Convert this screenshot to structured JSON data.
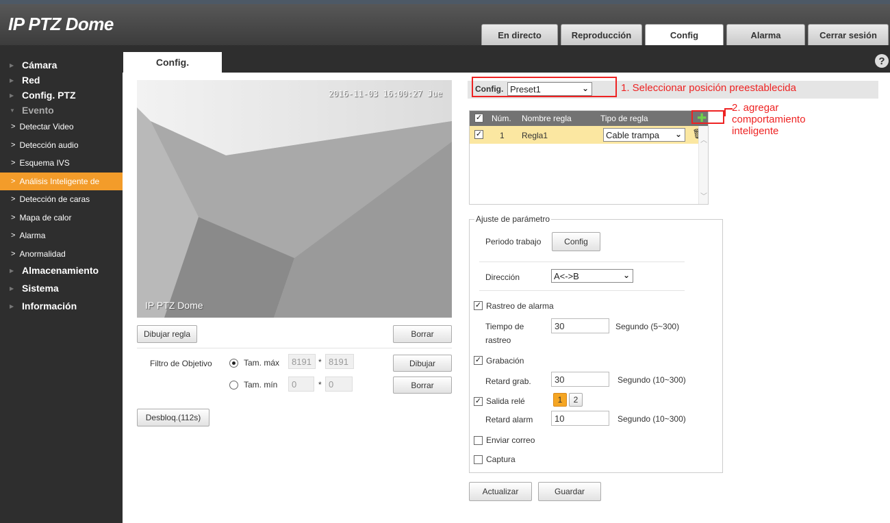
{
  "app": {
    "title": "IP PTZ Dome"
  },
  "tabs": [
    {
      "label": "En directo"
    },
    {
      "label": "Reproducción"
    },
    {
      "label": "Config",
      "active": true
    },
    {
      "label": "Alarma"
    },
    {
      "label": "Cerrar sesión"
    }
  ],
  "sidebar": {
    "top": [
      {
        "label": "Cámara"
      },
      {
        "label": "Red"
      },
      {
        "label": "Config. PTZ"
      },
      {
        "label": "Evento"
      }
    ],
    "sub": [
      {
        "label": "Detectar Video"
      },
      {
        "label": "Detección audio"
      },
      {
        "label": "Esquema IVS"
      },
      {
        "label": "Análisis Inteligente de",
        "active": true
      },
      {
        "label": "Detección de caras"
      },
      {
        "label": "Mapa de calor"
      },
      {
        "label": "Alarma"
      },
      {
        "label": "Anormalidad"
      }
    ],
    "bottom": [
      {
        "label": "Almacenamiento"
      },
      {
        "label": "Sistema"
      },
      {
        "label": "Información"
      }
    ]
  },
  "page": {
    "tab_label": "Config.",
    "help": "?"
  },
  "video": {
    "timestamp": "2016-11-03 16:00:27 Jue",
    "channel_name": "IP PTZ Dome"
  },
  "left": {
    "draw_rule": "Dibujar regla",
    "clear": "Borrar",
    "target_filter": "Filtro de Objetivo",
    "max_size": "Tam. máx",
    "min_size": "Tam. mín",
    "max_w": "8191",
    "max_h": "8191",
    "min_w": "0",
    "min_h": "0",
    "times": "*",
    "draw": "Dibujar",
    "clear2": "Borrar",
    "unlock": "Desbloq.(112s)"
  },
  "config": {
    "label": "Config.",
    "preset": "Preset1",
    "note1": "1. Seleccionar posición preestablecida",
    "note2_line1": "2. agregar",
    "note2_line2": "comportamiento",
    "note2_line3": "inteligente"
  },
  "rules": {
    "headers": {
      "num": "Núm.",
      "name": "Nombre regla",
      "type": "Tipo de regla"
    },
    "rows": [
      {
        "num": "1",
        "name": "Regla1",
        "type": "Cable trampa"
      }
    ]
  },
  "params": {
    "legend": "Ajuste de parámetro",
    "work_period": "Periodo trabajo",
    "config_btn": "Config",
    "direction": "Dirección",
    "direction_value": "A<->B",
    "alarm_track": "Rastreo de alarma",
    "track_time_1": "Tiempo de",
    "track_time_2": "rastreo",
    "track_time_value": "30",
    "track_time_unit": "Segundo (5~300)",
    "record": "Grabación",
    "record_delay": "Retard grab.",
    "record_delay_value": "30",
    "record_delay_unit": "Segundo (10~300)",
    "relay_out": "Salida relé",
    "relay_1": "1",
    "relay_2": "2",
    "alarm_delay": "Retard alarm",
    "alarm_delay_value": "10",
    "alarm_delay_unit": "Segundo (10~300)",
    "send_mail": "Enviar correo",
    "snapshot": "Captura"
  },
  "footer": {
    "refresh": "Actualizar",
    "save": "Guardar"
  },
  "colors": {
    "accent": "#f39c2a",
    "annotation": "#ee2222",
    "header": "#3c3c3c"
  }
}
